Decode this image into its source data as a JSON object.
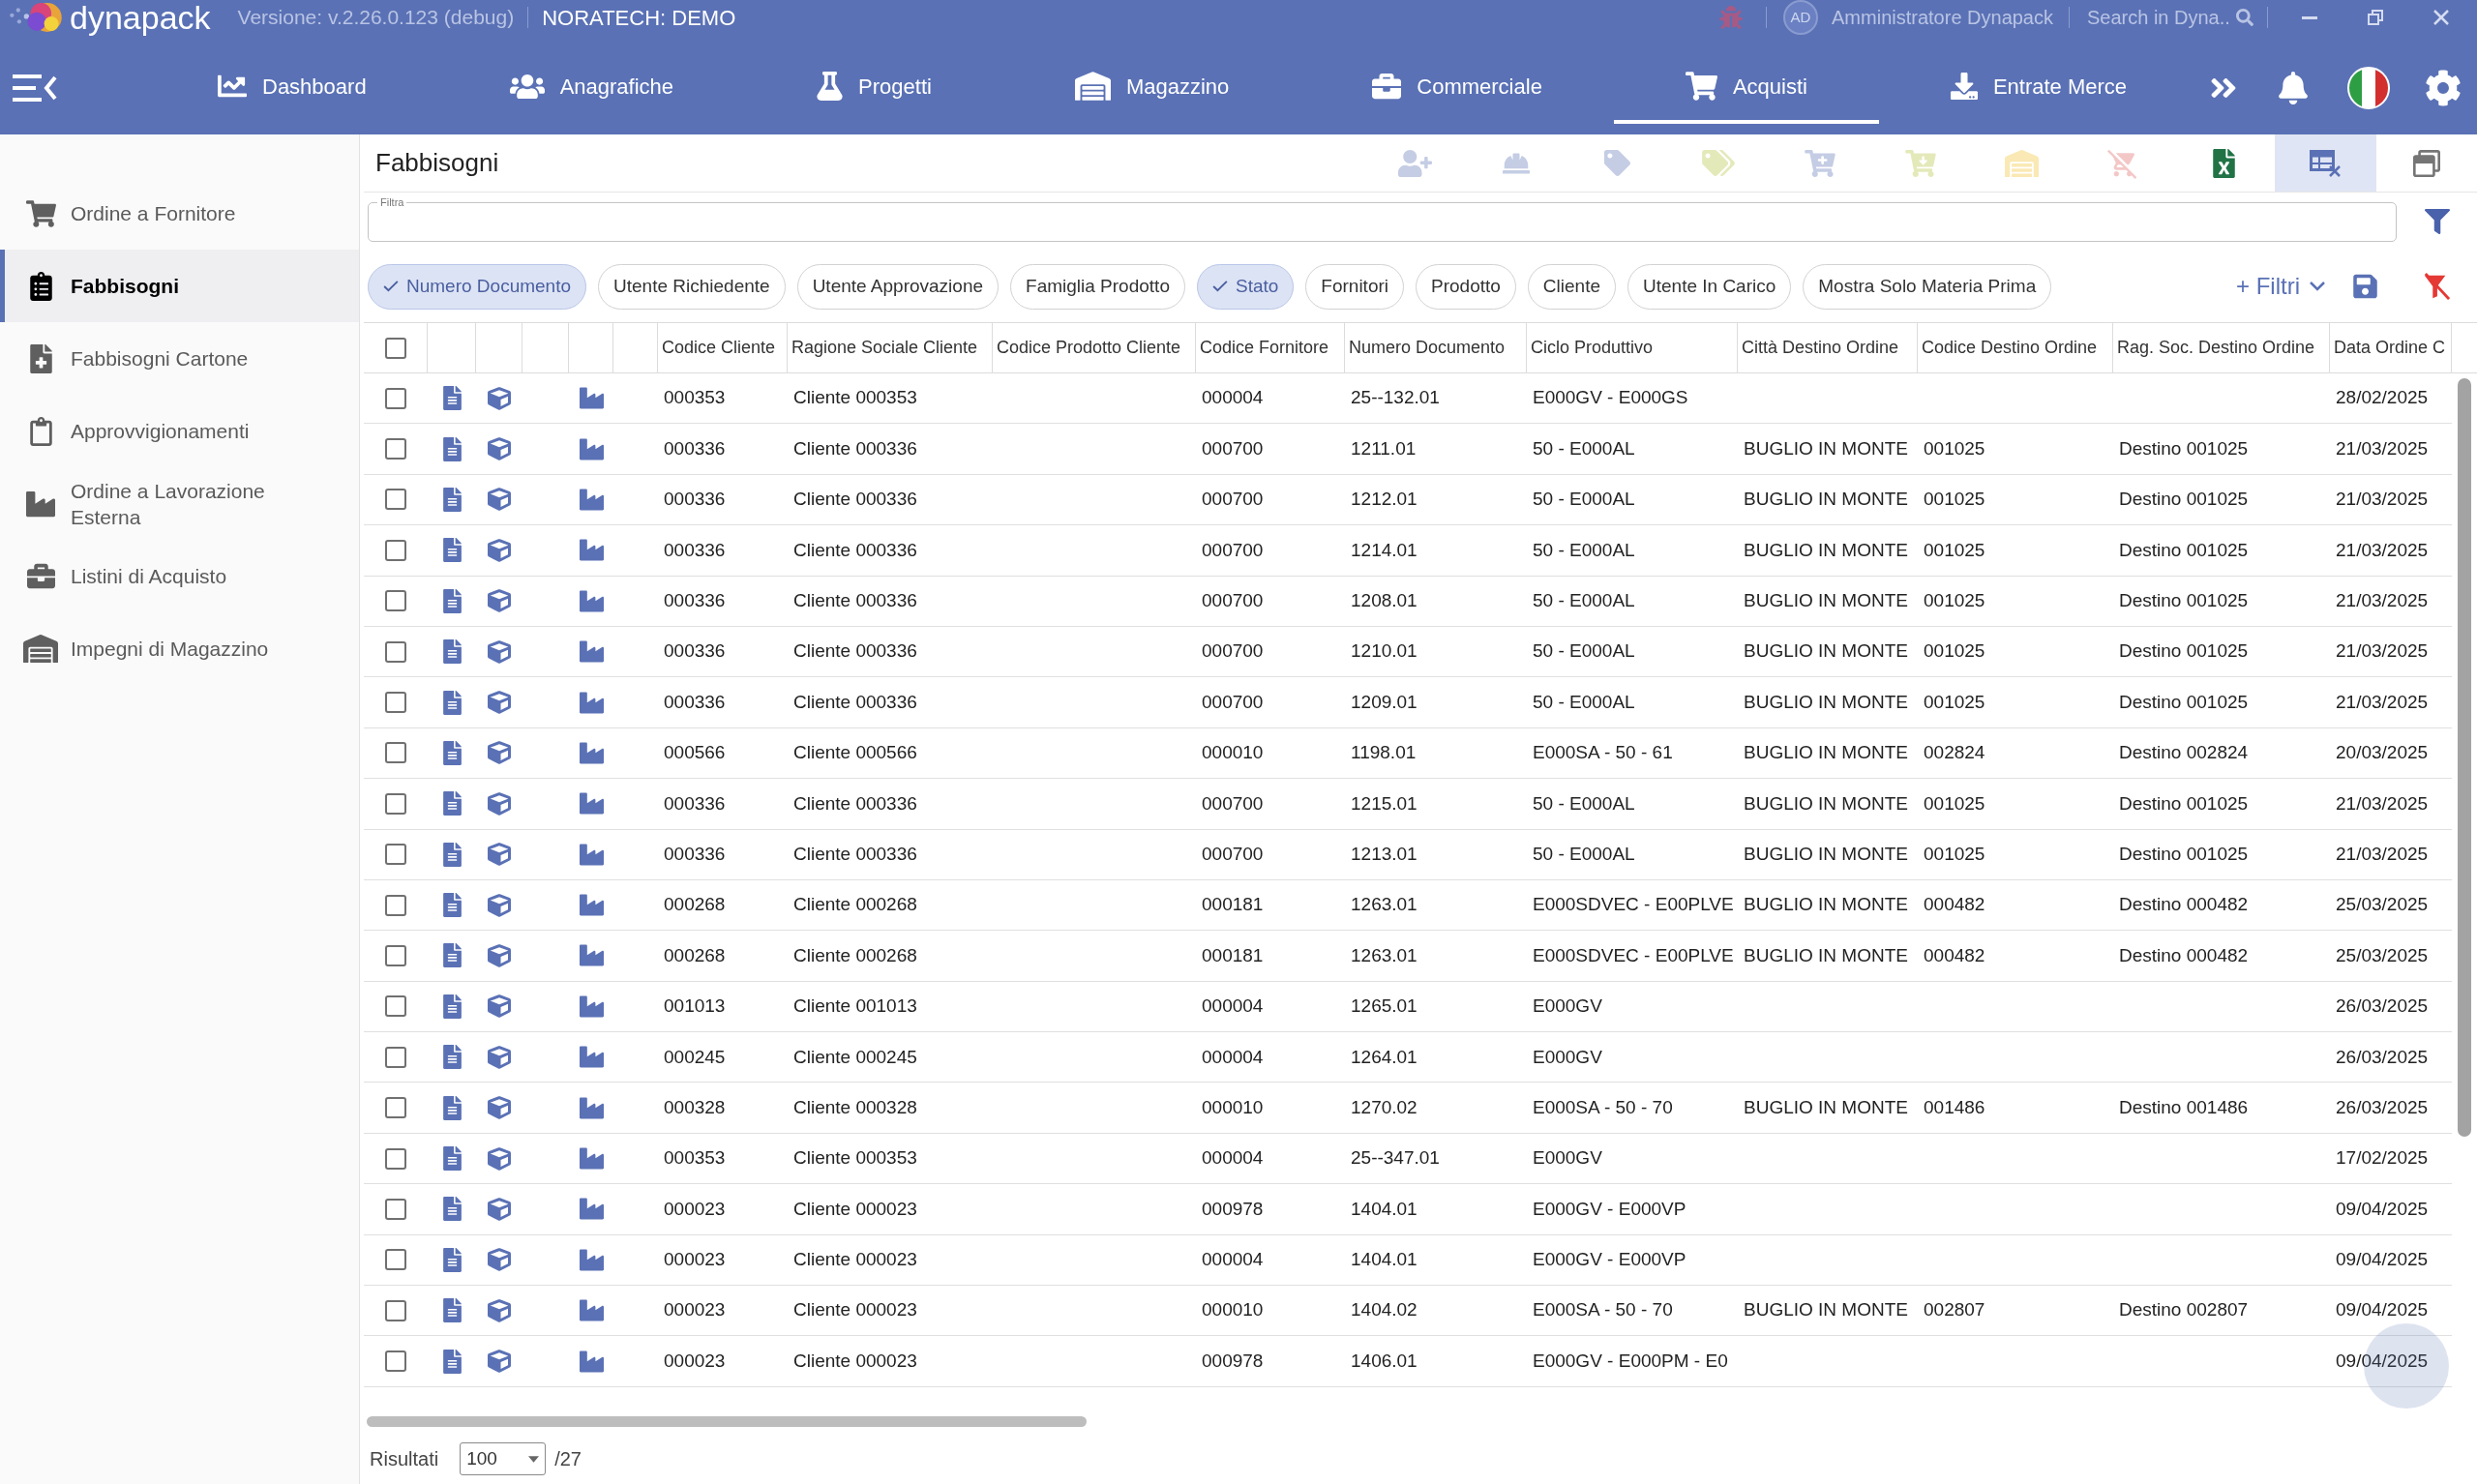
{
  "app_bar": {
    "logo": "dynapack",
    "version": "Versione: v.2.26.0.123 (debug)",
    "company": "NORATECH: DEMO",
    "user": {
      "initials": "AD",
      "name": "Amministratore Dynapack"
    },
    "search": {
      "placeholder": "Search in Dyna.."
    }
  },
  "nav": [
    {
      "kind": "dashboard",
      "label": "Dashboard",
      "selected": false
    },
    {
      "kind": "registry",
      "label": "Anagrafiche",
      "selected": false
    },
    {
      "kind": "projects",
      "label": "Progetti",
      "selected": false
    },
    {
      "kind": "warehouse",
      "label": "Magazzino",
      "selected": false
    },
    {
      "kind": "commercial",
      "label": "Commerciale",
      "selected": false
    },
    {
      "kind": "purchases",
      "label": "Acquisti",
      "selected": true
    },
    {
      "kind": "receipts",
      "label": "Entrate Merce",
      "selected": false
    }
  ],
  "sidebar": {
    "items": [
      {
        "kind": "cart",
        "label": "Ordine a Fornitore",
        "selected": false
      },
      {
        "kind": "list",
        "label": "Fabbisogni",
        "selected": true
      },
      {
        "kind": "file-plus",
        "label": "Fabbisogni Cartone",
        "selected": false
      },
      {
        "kind": "list-outline",
        "label": "Approvvigionamenti",
        "selected": false
      },
      {
        "kind": "factory",
        "label": "Ordine a Lavorazione Esterna",
        "selected": false
      },
      {
        "kind": "briefcase",
        "label": "Listini di Acquisto",
        "selected": false
      },
      {
        "kind": "warehouse",
        "label": "Impegni di Magazzino",
        "selected": false
      }
    ]
  },
  "page": {
    "title": "Fabbisogni"
  },
  "toolbar": [
    {
      "kind": "add-users",
      "disabled": true,
      "active": false
    },
    {
      "kind": "worker",
      "disabled": true,
      "active": false
    },
    {
      "kind": "add-tag",
      "disabled": true,
      "active": false
    },
    {
      "kind": "tags",
      "disabled": true,
      "active": false
    },
    {
      "kind": "add-to-cart",
      "disabled": true,
      "active": false
    },
    {
      "kind": "cart-download",
      "disabled": true,
      "active": false
    },
    {
      "kind": "warehouse",
      "disabled": true,
      "active": false
    },
    {
      "kind": "remove-from-cart",
      "disabled": true,
      "active": false
    },
    {
      "kind": "excel-export",
      "disabled": false,
      "active": false
    },
    {
      "kind": "table-remove",
      "disabled": false,
      "active": true
    },
    {
      "kind": "window",
      "disabled": false,
      "active": false
    }
  ],
  "filter_field": {
    "label": "Filtra"
  },
  "chips": [
    {
      "label": "Numero Documento",
      "selected": true
    },
    {
      "label": "Utente Richiedente",
      "selected": false
    },
    {
      "label": "Utente Approvazione",
      "selected": false
    },
    {
      "label": "Famiglia Prodotto",
      "selected": false
    },
    {
      "label": "Stato",
      "selected": true
    },
    {
      "label": "Fornitori",
      "selected": false
    },
    {
      "label": "Prodotto",
      "selected": false
    },
    {
      "label": "Cliente",
      "selected": false
    },
    {
      "label": "Utente In Carico",
      "selected": false
    },
    {
      "label": "Mostra Solo Materia Prima",
      "selected": false
    }
  ],
  "filters_button": {
    "label": "+ Filtri"
  },
  "table": {
    "all_checked": false,
    "columns": [
      "Codice Cliente",
      "Ragione Sociale Cliente",
      "Codice Prodotto Cliente",
      "Codice Fornitore",
      "Numero Documento",
      "Ciclo Produttivo",
      "Città Destino Ordine",
      "Codice Destino Ordine",
      "Rag. Soc. Destino Ordine",
      "Data Ordine C"
    ],
    "rows": [
      {
        "checked": false,
        "codice_cliente": "000353",
        "ragione_sociale_cliente": "Cliente 000353",
        "codice_fornitore": "000004",
        "numero_documento": "25--132.01",
        "ciclo_produttivo": "E000GV - E000GS",
        "data_ordine_c": "28/02/2025"
      },
      {
        "checked": false,
        "codice_cliente": "000336",
        "ragione_sociale_cliente": "Cliente 000336",
        "codice_fornitore": "000700",
        "numero_documento": "1211.01",
        "ciclo_produttivo": "50 - E000AL",
        "citta_destino_ordine": "BUGLIO IN MONTE",
        "codice_destino_ordine": "001025",
        "rag_soc_destino_ordine": "Destino 001025",
        "data_ordine_c": "21/03/2025"
      },
      {
        "checked": false,
        "codice_cliente": "000336",
        "ragione_sociale_cliente": "Cliente 000336",
        "codice_fornitore": "000700",
        "numero_documento": "1212.01",
        "ciclo_produttivo": "50 - E000AL",
        "citta_destino_ordine": "BUGLIO IN MONTE",
        "codice_destino_ordine": "001025",
        "rag_soc_destino_ordine": "Destino 001025",
        "data_ordine_c": "21/03/2025"
      },
      {
        "checked": false,
        "codice_cliente": "000336",
        "ragione_sociale_cliente": "Cliente 000336",
        "codice_fornitore": "000700",
        "numero_documento": "1214.01",
        "ciclo_produttivo": "50 - E000AL",
        "citta_destino_ordine": "BUGLIO IN MONTE",
        "codice_destino_ordine": "001025",
        "rag_soc_destino_ordine": "Destino 001025",
        "data_ordine_c": "21/03/2025"
      },
      {
        "checked": false,
        "codice_cliente": "000336",
        "ragione_sociale_cliente": "Cliente 000336",
        "codice_fornitore": "000700",
        "numero_documento": "1208.01",
        "ciclo_produttivo": "50 - E000AL",
        "citta_destino_ordine": "BUGLIO IN MONTE",
        "codice_destino_ordine": "001025",
        "rag_soc_destino_ordine": "Destino 001025",
        "data_ordine_c": "21/03/2025"
      },
      {
        "checked": false,
        "codice_cliente": "000336",
        "ragione_sociale_cliente": "Cliente 000336",
        "codice_fornitore": "000700",
        "numero_documento": "1210.01",
        "ciclo_produttivo": "50 - E000AL",
        "citta_destino_ordine": "BUGLIO IN MONTE",
        "codice_destino_ordine": "001025",
        "rag_soc_destino_ordine": "Destino 001025",
        "data_ordine_c": "21/03/2025"
      },
      {
        "checked": false,
        "codice_cliente": "000336",
        "ragione_sociale_cliente": "Cliente 000336",
        "codice_fornitore": "000700",
        "numero_documento": "1209.01",
        "ciclo_produttivo": "50 - E000AL",
        "citta_destino_ordine": "BUGLIO IN MONTE",
        "codice_destino_ordine": "001025",
        "rag_soc_destino_ordine": "Destino 001025",
        "data_ordine_c": "21/03/2025"
      },
      {
        "checked": false,
        "codice_cliente": "000566",
        "ragione_sociale_cliente": "Cliente 000566",
        "codice_fornitore": "000010",
        "numero_documento": "1198.01",
        "ciclo_produttivo": "E000SA - 50 - 61",
        "citta_destino_ordine": "BUGLIO IN MONTE",
        "codice_destino_ordine": "002824",
        "rag_soc_destino_ordine": "Destino 002824",
        "data_ordine_c": "20/03/2025"
      },
      {
        "checked": false,
        "codice_cliente": "000336",
        "ragione_sociale_cliente": "Cliente 000336",
        "codice_fornitore": "000700",
        "numero_documento": "1215.01",
        "ciclo_produttivo": "50 - E000AL",
        "citta_destino_ordine": "BUGLIO IN MONTE",
        "codice_destino_ordine": "001025",
        "rag_soc_destino_ordine": "Destino 001025",
        "data_ordine_c": "21/03/2025"
      },
      {
        "checked": false,
        "codice_cliente": "000336",
        "ragione_sociale_cliente": "Cliente 000336",
        "codice_fornitore": "000700",
        "numero_documento": "1213.01",
        "ciclo_produttivo": "50 - E000AL",
        "citta_destino_ordine": "BUGLIO IN MONTE",
        "codice_destino_ordine": "001025",
        "rag_soc_destino_ordine": "Destino 001025",
        "data_ordine_c": "21/03/2025"
      },
      {
        "checked": false,
        "codice_cliente": "000268",
        "ragione_sociale_cliente": "Cliente 000268",
        "codice_fornitore": "000181",
        "numero_documento": "1263.01",
        "ciclo_produttivo": "E000SDVEC - E00PLVE",
        "citta_destino_ordine": "BUGLIO IN MONTE",
        "codice_destino_ordine": "000482",
        "rag_soc_destino_ordine": "Destino 000482",
        "data_ordine_c": "25/03/2025"
      },
      {
        "checked": false,
        "codice_cliente": "000268",
        "ragione_sociale_cliente": "Cliente 000268",
        "codice_fornitore": "000181",
        "numero_documento": "1263.01",
        "ciclo_produttivo": "E000SDVEC - E00PLVE",
        "citta_destino_ordine": "BUGLIO IN MONTE",
        "codice_destino_ordine": "000482",
        "rag_soc_destino_ordine": "Destino 000482",
        "data_ordine_c": "25/03/2025"
      },
      {
        "checked": false,
        "codice_cliente": "001013",
        "ragione_sociale_cliente": "Cliente 001013",
        "codice_fornitore": "000004",
        "numero_documento": "1265.01",
        "ciclo_produttivo": "E000GV",
        "data_ordine_c": "26/03/2025"
      },
      {
        "checked": false,
        "codice_cliente": "000245",
        "ragione_sociale_cliente": "Cliente 000245",
        "codice_fornitore": "000004",
        "numero_documento": "1264.01",
        "ciclo_produttivo": "E000GV",
        "data_ordine_c": "26/03/2025"
      },
      {
        "checked": false,
        "codice_cliente": "000328",
        "ragione_sociale_cliente": "Cliente 000328",
        "codice_fornitore": "000010",
        "numero_documento": "1270.02",
        "ciclo_produttivo": "E000SA - 50 - 70",
        "citta_destino_ordine": "BUGLIO IN MONTE",
        "codice_destino_ordine": "001486",
        "rag_soc_destino_ordine": "Destino 001486",
        "data_ordine_c": "26/03/2025"
      },
      {
        "checked": false,
        "codice_cliente": "000353",
        "ragione_sociale_cliente": "Cliente 000353",
        "codice_fornitore": "000004",
        "numero_documento": "25--347.01",
        "ciclo_produttivo": "E000GV",
        "data_ordine_c": "17/02/2025"
      },
      {
        "checked": false,
        "codice_cliente": "000023",
        "ragione_sociale_cliente": "Cliente 000023",
        "codice_fornitore": "000978",
        "numero_documento": "1404.01",
        "ciclo_produttivo": "E000GV - E000VP",
        "data_ordine_c": "09/04/2025"
      },
      {
        "checked": false,
        "codice_cliente": "000023",
        "ragione_sociale_cliente": "Cliente 000023",
        "codice_fornitore": "000004",
        "numero_documento": "1404.01",
        "ciclo_produttivo": "E000GV - E000VP",
        "data_ordine_c": "09/04/2025"
      },
      {
        "checked": false,
        "codice_cliente": "000023",
        "ragione_sociale_cliente": "Cliente 000023",
        "codice_fornitore": "000010",
        "numero_documento": "1404.02",
        "ciclo_produttivo": "E000SA - 50 - 70",
        "citta_destino_ordine": "BUGLIO IN MONTE",
        "codice_destino_ordine": "002807",
        "rag_soc_destino_ordine": "Destino 002807",
        "data_ordine_c": "09/04/2025"
      },
      {
        "checked": false,
        "codice_cliente": "000023",
        "ragione_sociale_cliente": "Cliente 000023",
        "codice_fornitore": "000978",
        "numero_documento": "1406.01",
        "ciclo_produttivo": "E000GV - E000PM - E0",
        "data_ordine_c": "09/04/2025"
      }
    ]
  },
  "pager": {
    "label": "Risultati",
    "page_size": "100",
    "total": "/27"
  }
}
